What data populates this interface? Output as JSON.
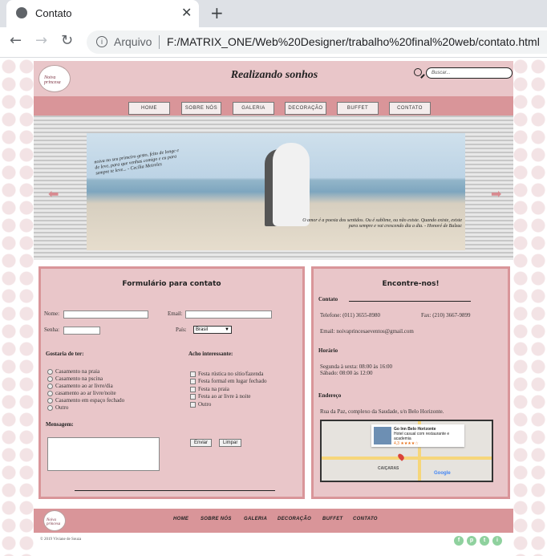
{
  "browser": {
    "tab_title": "Contato",
    "tab_close": "✕",
    "new_tab": "+",
    "back": "←",
    "forward": "→",
    "reload": "↻",
    "info": "i",
    "omni_label": "Arquivo",
    "url": "F:/MATRIX_ONE/Web%20Designer/trabalho%20final%20web/contato.html"
  },
  "header": {
    "logo_text": "Noiva princesa",
    "slogan": "Realizando sonhos",
    "search_placeholder": "Buscar...",
    "nav": [
      "HOME",
      "SOBRE NÓS",
      "GALERIA",
      "DECORAÇÃO",
      "BUFFET",
      "CONTATO"
    ]
  },
  "hero": {
    "quote_left": "noiva no seu primeiro gesto, feito de longe e de leve, para que venhas comigo e eu para sempre te leve... - Cecília Meireles",
    "quote_right": "O amor é a poesia dos sentidos. Ou é sublime, ou não existe. Quando existe, existe para sempre e vai crescendo dia a dia. - Honoré de Balzac",
    "prev": "⬅",
    "next": "➡"
  },
  "form": {
    "title": "Formulário para contato",
    "name_label": "Nome:",
    "email_label": "Email:",
    "password_label": "Senha:",
    "country_label": "País:",
    "country_value": "Brasil",
    "wish_title": "Gostaria de ter:",
    "wish_options": [
      "Casamento na praia",
      "Casamento na pscina",
      "Casamento ao ar livre/dia",
      "casamento ao ar livre/noite",
      "Casamento em espaço fechado",
      "Outro"
    ],
    "interest_title": "Acho interessante:",
    "interest_options": [
      "Festa rústica no sítio/fazenda",
      "Festa formal em lugar fechado",
      "Festa na praia",
      "Festa ao ar livre à noite",
      "Outro"
    ],
    "message_label": "Mensagem:",
    "send_label": "Enviar",
    "clear_label": "Limpar"
  },
  "contact": {
    "title": "Encontre-nos!",
    "contact_heading": "Contato",
    "phone": "Telefone: (011) 3655-8980",
    "fax": "Fax: (210) 3667-9899",
    "email": "Email: noivaprincesaeventos@gmail.com",
    "hours_heading": "Horário",
    "hours_week": "Segunda à sexta: 08:00 às 16:00",
    "hours_sat": "Sábado: 08:00 às 12:00",
    "address_heading": "Endereço",
    "address": "Rua da Paz, complexo da Saudade, s/n Belo Horizonte.",
    "map_title": "Go Inn Belo Horizonte",
    "map_desc": "Hotel casual com restaurante e academia",
    "map_rating": "4,3 ★★★★☆",
    "map_area": "CAIÇARAS",
    "map_brand": "Google"
  },
  "footer": {
    "logo_text": "Noiva princesa",
    "nav": [
      "HOME",
      "SOBRE NÓS",
      "GALERIA",
      "DECORAÇÃO",
      "BUFFET",
      "CONTATO"
    ],
    "copyright": "© 2019 Viviane de Souza",
    "social": [
      "f",
      "p",
      "t",
      "i"
    ]
  }
}
